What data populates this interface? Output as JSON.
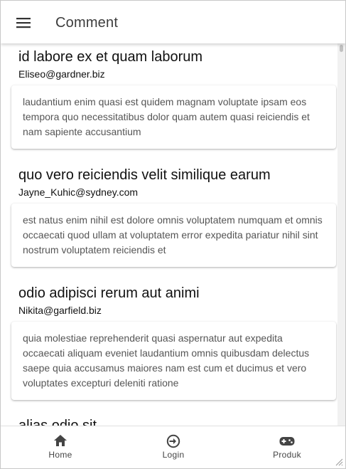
{
  "header": {
    "title": "Comment",
    "menu_icon": "menu-icon"
  },
  "comments": [
    {
      "name": "id labore ex et quam laborum",
      "email": "Eliseo@gardner.biz",
      "body": "laudantium enim quasi est quidem magnam voluptate ipsam eos tempora quo necessitatibus dolor quam autem quasi reiciendis et nam sapiente accusantium"
    },
    {
      "name": "quo vero reiciendis velit similique earum",
      "email": "Jayne_Kuhic@sydney.com",
      "body": "est natus enim nihil est dolore omnis voluptatem numquam et omnis occaecati quod ullam at voluptatem error expedita pariatur nihil sint nostrum voluptatem reiciendis et"
    },
    {
      "name": "odio adipisci rerum aut animi",
      "email": "Nikita@garfield.biz",
      "body": "quia molestiae reprehenderit quasi aspernatur aut expedita occaecati aliquam eveniet laudantium omnis quibusdam delectus saepe quia accusamus maiores nam est cum et ducimus et vero voluptates excepturi deleniti ratione"
    },
    {
      "name": "alias odio sit",
      "email": "",
      "body": ""
    }
  ],
  "bottom_nav": {
    "items": [
      {
        "label": "Home",
        "icon": "home-icon"
      },
      {
        "label": "Login",
        "icon": "login-icon"
      },
      {
        "label": "Produk",
        "icon": "gamepad-icon"
      }
    ]
  }
}
